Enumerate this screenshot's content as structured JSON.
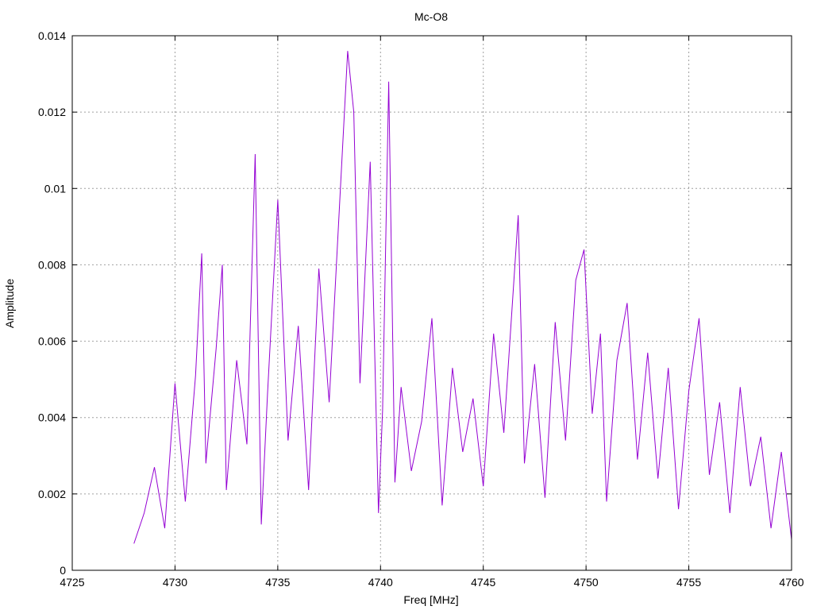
{
  "chart_data": {
    "type": "line",
    "title": "Mc-O8",
    "xlabel": "Freq [MHz]",
    "ylabel": "Amplitude",
    "xlim": [
      4725,
      4760
    ],
    "ylim": [
      0,
      0.014
    ],
    "x_ticks": [
      4725,
      4730,
      4735,
      4740,
      4745,
      4750,
      4755,
      4760
    ],
    "x_tick_labels": [
      "4725",
      "4730",
      "4735",
      "4740",
      "4745",
      "4750",
      "4755",
      "4760"
    ],
    "y_ticks": [
      0,
      0.002,
      0.004,
      0.006,
      0.008,
      0.01,
      0.012,
      0.014
    ],
    "y_tick_labels": [
      "0",
      "0.002",
      "0.004",
      "0.006",
      "0.008",
      "0.01",
      "0.012",
      "0.014"
    ],
    "grid": true,
    "line_color": "#9400d3",
    "series": [
      {
        "x": [
          4728.0,
          4728.5,
          4729.0,
          4729.5,
          4730.0,
          4730.5,
          4731.0,
          4731.3,
          4731.5,
          4732.0,
          4732.3,
          4732.5,
          4733.0,
          4733.5,
          4733.9,
          4734.2,
          4734.5,
          4735.0,
          4735.5,
          4736.0,
          4736.5,
          4737.0,
          4737.5,
          4738.0,
          4738.4,
          4738.7,
          4739.0,
          4739.5,
          4739.9,
          4740.1,
          4740.4,
          4740.7,
          4741.0,
          4741.5,
          4742.0,
          4742.5,
          4743.0,
          4743.5,
          4744.0,
          4744.5,
          4745.0,
          4745.5,
          4746.0,
          4746.7,
          4747.0,
          4747.5,
          4748.0,
          4748.5,
          4749.0,
          4749.5,
          4749.9,
          4750.3,
          4750.7,
          4751.0,
          4751.5,
          4752.0,
          4752.5,
          4753.0,
          4753.5,
          4754.0,
          4754.5,
          4755.0,
          4755.5,
          4756.0,
          4756.5,
          4757.0,
          4757.5,
          4758.0,
          4758.5,
          4759.0,
          4759.5,
          4760.0
        ],
        "y": [
          0.0007,
          0.0015,
          0.0027,
          0.0011,
          0.0049,
          0.0018,
          0.0051,
          0.0083,
          0.0028,
          0.0058,
          0.008,
          0.0021,
          0.0055,
          0.0033,
          0.0109,
          0.0012,
          0.0046,
          0.0097,
          0.0034,
          0.0064,
          0.0021,
          0.0079,
          0.0044,
          0.0095,
          0.0136,
          0.012,
          0.0049,
          0.0107,
          0.0015,
          0.0042,
          0.0128,
          0.0023,
          0.0048,
          0.0026,
          0.0039,
          0.0066,
          0.0017,
          0.0053,
          0.0031,
          0.0045,
          0.0022,
          0.0062,
          0.0036,
          0.0093,
          0.0028,
          0.0054,
          0.0019,
          0.0065,
          0.0034,
          0.0076,
          0.0084,
          0.0041,
          0.0062,
          0.0018,
          0.0055,
          0.007,
          0.0029,
          0.0057,
          0.0024,
          0.0053,
          0.0016,
          0.0047,
          0.0066,
          0.0025,
          0.0044,
          0.0015,
          0.0048,
          0.0022,
          0.0035,
          0.0011,
          0.0031,
          0.0008
        ]
      }
    ]
  }
}
